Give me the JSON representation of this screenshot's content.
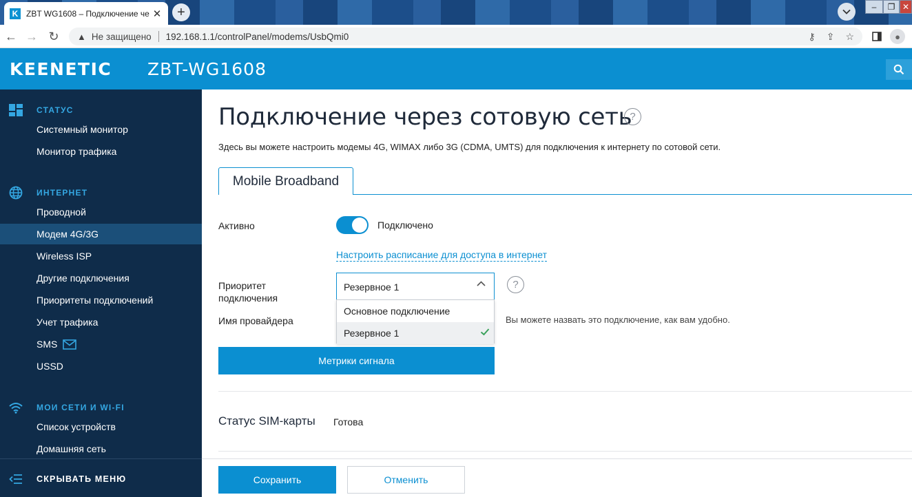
{
  "browser": {
    "tab_title": "ZBT WG1608 – Подключение че",
    "tab_favicon_letter": "K",
    "url_security": "Не защищено",
    "url": "192.168.1.1/controlPanel/modems/UsbQmi0"
  },
  "header": {
    "brand": "KEENETIC",
    "model": "ZBT-WG1608"
  },
  "sidebar": {
    "sections": [
      {
        "label": "СТАТУС",
        "icon": "dashboard-icon"
      },
      {
        "label": "ИНТЕРНЕТ",
        "icon": "globe-icon"
      },
      {
        "label": "МОИ СЕТИ И WI-FI",
        "icon": "wifi-icon"
      }
    ],
    "items": [
      {
        "label": "Системный монитор"
      },
      {
        "label": "Монитор трафика"
      },
      {
        "label": "Проводной"
      },
      {
        "label": "Модем 4G/3G",
        "active": true
      },
      {
        "label": "Wireless ISP"
      },
      {
        "label": "Другие подключения"
      },
      {
        "label": "Приоритеты подключений"
      },
      {
        "label": "Учет трафика"
      },
      {
        "label": "SMS",
        "icon": "envelope-icon"
      },
      {
        "label": "USSD"
      },
      {
        "label": "Список устройств"
      },
      {
        "label": "Домашняя сеть"
      }
    ],
    "collapse_label": "СКРЫВАТЬ МЕНЮ"
  },
  "main": {
    "title": "Подключение через сотовую сеть",
    "description": "Здесь вы можете настроить модемы 4G, WIMAX либо 3G (CDMA, UMTS) для подключения к интернету по сотовой сети.",
    "tab": "Mobile Broadband",
    "active_label": "Активно",
    "active_state": "Подключено",
    "schedule_link": "Настроить расписание для доступа в интернет",
    "priority_label_line1": "Приоритет",
    "priority_label_line2": "подключения",
    "priority_value": "Резервное 1",
    "priority_options": [
      {
        "label": "Основное подключение",
        "selected": false
      },
      {
        "label": "Резервное 1",
        "selected": true
      }
    ],
    "provider_label": "Имя провайдера",
    "provider_hint": "Вы можете назвать это подключение, как вам удобно.",
    "signal_button": "Метрики сигнала",
    "sim_status_label": "Статус SIM-карты",
    "sim_status_value": "Готова",
    "save_button": "Сохранить",
    "cancel_button": "Отменить"
  },
  "colors": {
    "accent": "#0b8fd1",
    "sidebar_bg": "#0f2c4a",
    "sidebar_active": "#1b4f79",
    "section_label": "#34a7e2",
    "check": "#3aa15b"
  }
}
